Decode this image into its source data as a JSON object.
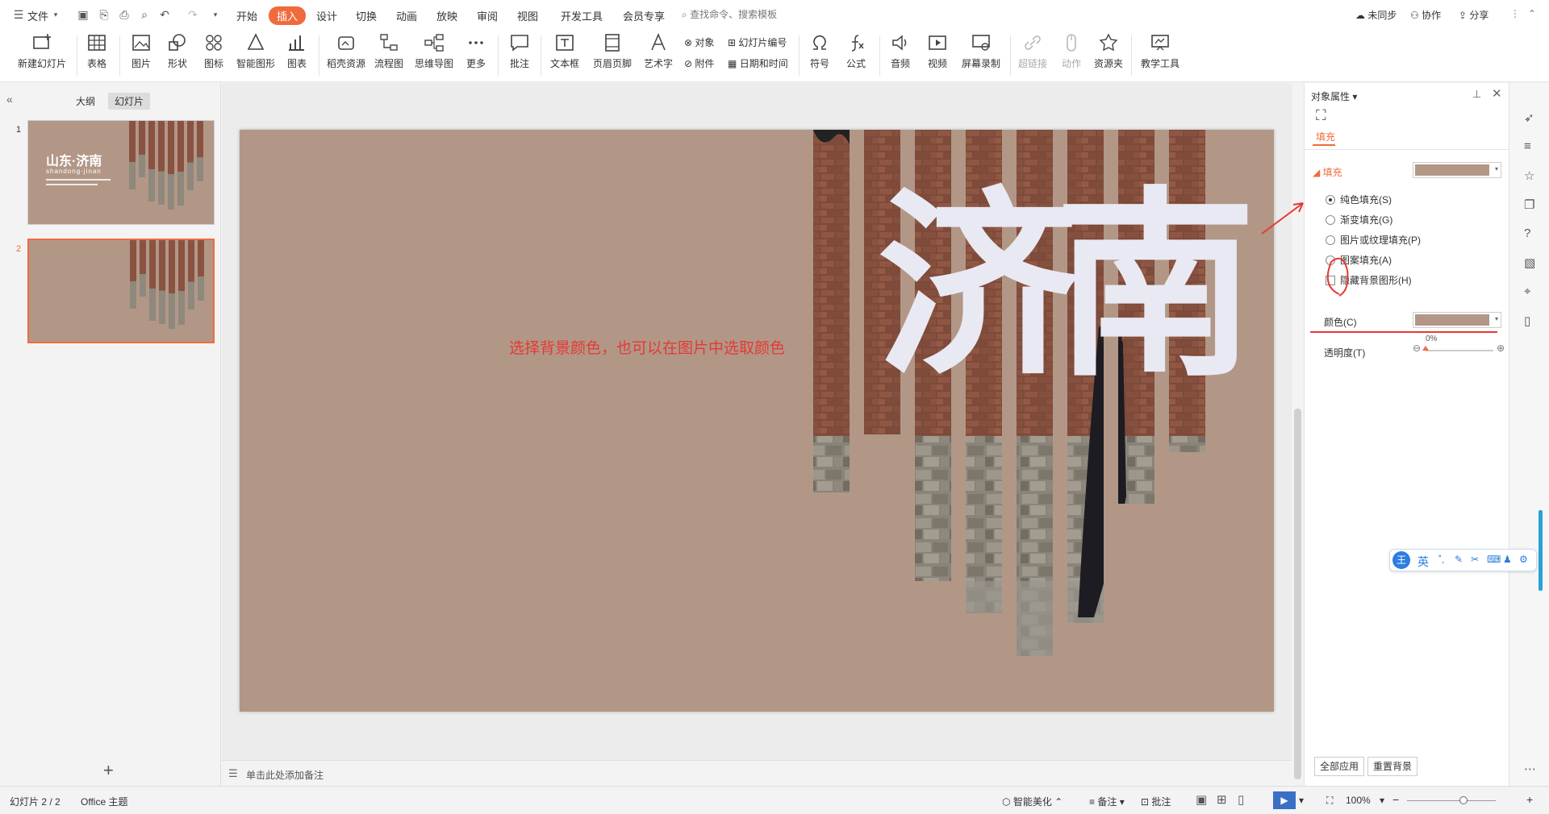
{
  "menu": {
    "file": "文件",
    "tabs": [
      "开始",
      "插入",
      "设计",
      "切换",
      "动画",
      "放映",
      "审阅",
      "视图",
      "开发工具",
      "会员专享"
    ],
    "active_tab": "插入",
    "search_placeholder": "查找命令、搜索模板",
    "right": {
      "sync": "未同步",
      "collab": "协作",
      "share": "分享"
    }
  },
  "ribbon": {
    "new_slide": "新建幻灯片",
    "table": "表格",
    "picture": "图片",
    "shape": "形状",
    "icon": "图标",
    "smart_graphic": "智能图形",
    "chart": "图表",
    "docer": "稻壳资源",
    "flowchart": "流程图",
    "mindmap": "思维导图",
    "more": "更多",
    "comment": "批注",
    "textbox": "文本框",
    "header_footer": "页眉页脚",
    "wordart": "艺术字",
    "object": "对象",
    "attachment": "附件",
    "slide_number": "幻灯片编号",
    "date_time": "日期和时间",
    "symbol": "符号",
    "formula": "公式",
    "audio": "音频",
    "video": "视频",
    "screen_record": "屏幕录制",
    "hyperlink": "超链接",
    "action": "动作",
    "resource": "资源夹",
    "teaching": "教学工具"
  },
  "left_panel": {
    "tab_outline": "大纲",
    "tab_slides": "幻灯片",
    "slides": [
      {
        "num": "1",
        "title": "山东·济南",
        "subtitle": "shandong·jinan"
      },
      {
        "num": "2"
      }
    ],
    "add": "+"
  },
  "slide": {
    "annotation": "选择背景颜色，也可以在图片中选取颜色",
    "char1": "济",
    "char2": "南",
    "bg_color": "#B29787"
  },
  "notes": {
    "placeholder": "单击此处添加备注"
  },
  "right_panel": {
    "title": "对象属性",
    "tab": "填充",
    "section": "填充",
    "options": [
      "纯色填充(S)",
      "渐变填充(G)",
      "图片或纹理填充(P)",
      "图案填充(A)"
    ],
    "selected_option": "纯色填充(S)",
    "hide_bg": "隐藏背景图形(H)",
    "color_label": "颜色(C)",
    "transparency_label": "透明度(T)",
    "transparency_value": "0%",
    "transparency_level": 0,
    "apply_all": "全部应用",
    "reset_bg": "重置背景",
    "fill_color": "#B29787"
  },
  "status": {
    "slide_count": "幻灯片 2 / 2",
    "theme": "Office 主题",
    "beautify": "智能美化",
    "notes": "备注",
    "comment": "批注",
    "zoom": "100%",
    "zoom_level": 1.0
  },
  "ime": {
    "lang": "英"
  },
  "colors": {
    "accent": "#F06B3C",
    "annotation": "#E53935"
  }
}
